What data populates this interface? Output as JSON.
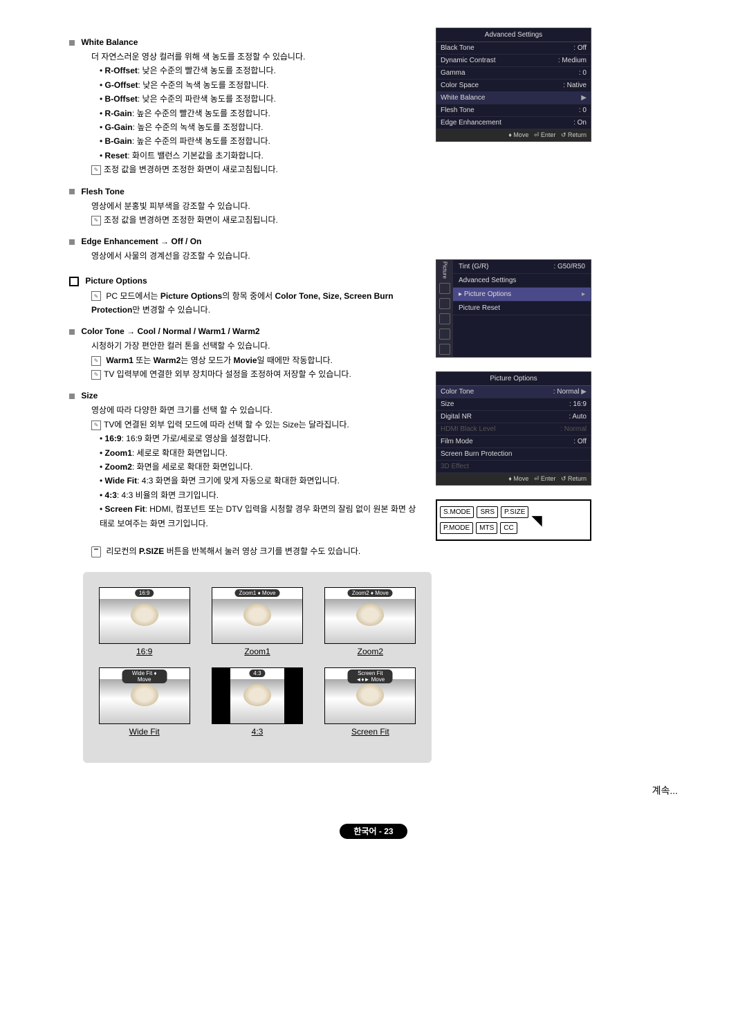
{
  "whiteBalance": {
    "title": "White Balance",
    "desc": "더 자연스러운 영상 컬러를 위해 색 농도를 조정할 수 있습니다.",
    "items": [
      {
        "label": "R-Offset",
        "text": ": 낮은 수준의 빨간색 농도를 조정합니다."
      },
      {
        "label": "G-Offset",
        "text": ": 낮은 수준의 녹색 농도를 조정합니다."
      },
      {
        "label": "B-Offset",
        "text": ": 낮은 수준의 파란색 농도를 조정합니다."
      },
      {
        "label": "R-Gain",
        "text": ": 높은 수준의 빨간색 농도를 조정합니다."
      },
      {
        "label": "G-Gain",
        "text": ": 높은 수준의 녹색 농도를 조정합니다."
      },
      {
        "label": "B-Gain",
        "text": ": 높은 수준의 파란색 농도를 조정합니다."
      },
      {
        "label": "Reset",
        "text": ": 화이트 밸런스 기본값을 초기화합니다."
      }
    ],
    "note": "조정 값을 변경하면 조정한 화면이 새로고침됩니다."
  },
  "fleshTone": {
    "title": "Flesh Tone",
    "desc": "영상에서 분홍빛 피부색을 강조할 수 있습니다.",
    "note": "조정 값을 변경하면 조정한 화면이 새로고침됩니다."
  },
  "edgeEnhancement": {
    "title": "Edge Enhancement → Off / On",
    "desc": "영상에서 사물의 경계선을 강조할 수 있습니다."
  },
  "pictureOptions": {
    "title": "Picture Options",
    "note1a": "PC 모드에서는 ",
    "note1b": "Picture Options",
    "note1c": "의 항목 중에서 ",
    "note1d": "Color Tone, Size, Screen Burn Protection",
    "note1e": "만 변경할 수 있습니다."
  },
  "colorTone": {
    "title": "Color Tone → Cool / Normal / Warm1 / Warm2",
    "desc": "시청하기 가장 편안한 컬러 톤을 선택할 수 있습니다.",
    "note1a": "Warm1",
    "note1b": " 또는 ",
    "note1c": "Warm2",
    "note1d": "는 영상 모드가 ",
    "note1e": "Movie",
    "note1f": "일 때에만 작동합니다.",
    "note2": "TV 입력부에 연결한 외부 장치마다 설정을 조정하여 저장할 수 있습니다."
  },
  "size": {
    "title": "Size",
    "desc": "영상에 따라 다양한 화면 크기를 선택 할 수 있습니다.",
    "note1": "TV에 연결된 외부 입력 모드에 따라 선택 할 수 있는 Size는 달라집니다.",
    "items": [
      {
        "label": "16:9",
        "text": ": 16:9 화면 가로/세로로 영상을 설정합니다."
      },
      {
        "label": "Zoom1",
        "text": ": 세로로 확대한 화면입니다."
      },
      {
        "label": "Zoom2",
        "text": ": 화면을 세로로 확대한 화면입니다."
      },
      {
        "label": "Wide Fit",
        "text": ": 4:3 화면을 화면 크기에 맞게 자동으로 확대한 화면입니다."
      },
      {
        "label": "4:3",
        "text": ": 4:3 비율의 화면 크기입니다."
      },
      {
        "label": "Screen Fit",
        "text": ": HDMI, 컴포넌트 또는 DTV 입력을 시청할 경우 화면의 잘림 없이 원본 화면 상태로 보여주는 화면 크기입니다."
      }
    ],
    "remoteNote1": "리모컨의 ",
    "remoteNote2": "P.SIZE",
    "remoteNote3": " 버튼을 반복해서 눌러 영상 크기를 변경할 수도 있습니다."
  },
  "osd1": {
    "title": "Advanced Settings",
    "rows": [
      {
        "label": "Black Tone",
        "value": ": Off"
      },
      {
        "label": "Dynamic Contrast",
        "value": ": Medium"
      },
      {
        "label": "Gamma",
        "value": ": 0"
      },
      {
        "label": "Color Space",
        "value": ": Native"
      },
      {
        "label": "White Balance",
        "value": "",
        "highlight": true,
        "arrow": true
      },
      {
        "label": "Flesh Tone",
        "value": ": 0"
      },
      {
        "label": "Edge Enhancement",
        "value": ": On"
      }
    ],
    "footer": {
      "move": "Move",
      "enter": "Enter",
      "return": "Return"
    }
  },
  "osd2": {
    "sidebar": "Picture",
    "rows": [
      {
        "label": "Tint (G/R)",
        "value": ": G50/R50"
      },
      {
        "label": "Advanced Settings",
        "value": ""
      },
      {
        "label": "Picture Options",
        "value": "",
        "highlight": true,
        "arrow": true
      },
      {
        "label": "Picture Reset",
        "value": ""
      }
    ]
  },
  "osd3": {
    "title": "Picture Options",
    "rows": [
      {
        "label": "Color Tone",
        "value": ": Normal",
        "highlight": true,
        "arrow": true
      },
      {
        "label": "Size",
        "value": ": 16:9"
      },
      {
        "label": "Digital NR",
        "value": ": Auto"
      },
      {
        "label": "HDMI Black Level",
        "value": ": Normal",
        "disabled": true
      },
      {
        "label": "Film Mode",
        "value": ": Off"
      },
      {
        "label": "Screen Burn Protection",
        "value": ""
      },
      {
        "label": "3D Effect",
        "value": "",
        "disabled": true
      }
    ],
    "footer": {
      "move": "Move",
      "enter": "Enter",
      "return": "Return"
    }
  },
  "remote": {
    "buttons": [
      [
        "S.MODE",
        "SRS",
        "P.SIZE"
      ],
      [
        "P.MODE",
        "MTS",
        "CC"
      ]
    ]
  },
  "sizeThumbs": [
    [
      {
        "tag": "16:9",
        "caption": "16:9"
      },
      {
        "tag": "Zoom1 ♦ Move",
        "caption": "Zoom1"
      },
      {
        "tag": "Zoom2 ♦ Move",
        "caption": "Zoom2"
      }
    ],
    [
      {
        "tag": "Wide Fit ♦ Move",
        "caption": "Wide Fit"
      },
      {
        "tag": "4:3",
        "caption": "4:3",
        "narrow": true
      },
      {
        "tag": "Screen Fit ◄♦► Move",
        "caption": "Screen Fit"
      }
    ]
  ],
  "continue": "계속...",
  "pageFooter": "한국어 - 23"
}
